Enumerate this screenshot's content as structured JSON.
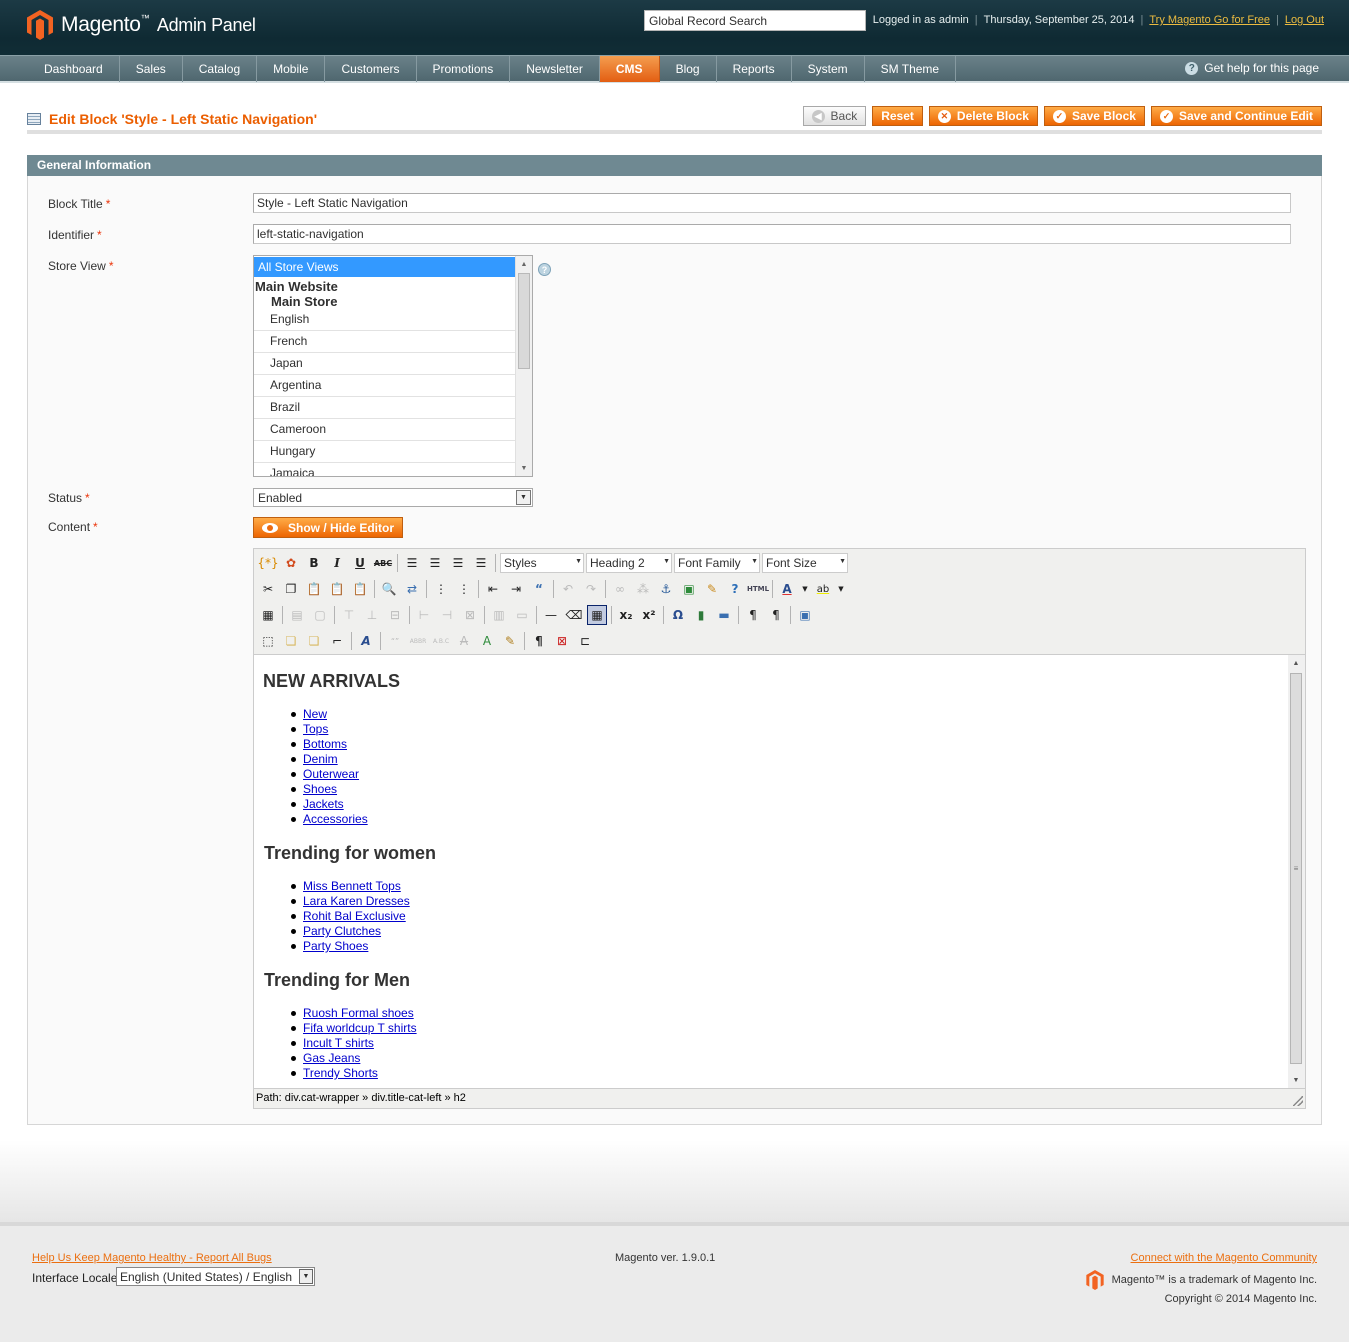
{
  "header": {
    "logo_text": "Magento",
    "logo_tm": "™",
    "logo_suffix": "Admin Panel",
    "search_value": "Global Record Search",
    "logged_in": "Logged in as admin",
    "date": "Thursday, September 25, 2014",
    "try_link": "Try Magento Go for Free",
    "logout": "Log Out",
    "brand_color": "#eb5e00"
  },
  "nav": {
    "items": [
      "Dashboard",
      "Sales",
      "Catalog",
      "Mobile",
      "Customers",
      "Promotions",
      "Newsletter",
      "CMS",
      "Blog",
      "Reports",
      "System",
      "SM Theme"
    ],
    "active": "CMS",
    "help": "Get help for this page"
  },
  "page": {
    "title": "Edit Block 'Style - Left Static Navigation'",
    "buttons": {
      "back": "Back",
      "reset": "Reset",
      "delete": "Delete Block",
      "save": "Save Block",
      "save_continue": "Save and Continue Edit"
    }
  },
  "form": {
    "section_title": "General Information",
    "block_title_label": "Block Title",
    "block_title_value": "Style - Left Static Navigation",
    "identifier_label": "Identifier",
    "identifier_value": "left-static-navigation",
    "store_view_label": "Store View",
    "store_views": {
      "all": "All Store Views",
      "website": "Main Website",
      "store": "Main Store",
      "views": [
        "English",
        "French",
        "Japan",
        "Argentina",
        "Brazil",
        "Cameroon",
        "Hungary",
        "Jamaica"
      ]
    },
    "status_label": "Status",
    "status_value": "Enabled",
    "content_label": "Content",
    "required_mark": "*",
    "show_hide_editor": "Show / Hide Editor"
  },
  "editor": {
    "toolbar": {
      "styles": "Styles",
      "heading": "Heading 2",
      "font_family": "Font Family",
      "font_size": "Font Size"
    },
    "sections": [
      {
        "heading": "NEW ARRIVALS",
        "links": [
          "New",
          "Tops",
          "Bottoms",
          "Denim",
          "Outerwear",
          "Shoes",
          "Jackets",
          "Accessories"
        ]
      },
      {
        "heading": "Trending for women",
        "links": [
          "Miss Bennett Tops",
          "Lara Karen Dresses",
          "Rohit Bal Exclusive",
          "Party Clutches",
          "Party Shoes"
        ]
      },
      {
        "heading": "Trending for Men",
        "links": [
          "Ruosh Formal shoes",
          "Fifa worldcup T shirts",
          "Incult T shirts",
          "Gas Jeans",
          "Trendy Shorts"
        ]
      }
    ],
    "path": "Path: div.cat-wrapper » div.title-cat-left » h2"
  },
  "footer": {
    "bugs_link": "Help Us Keep Magento Healthy - Report All Bugs",
    "locale_label": "Interface Locale:",
    "locale_value": "English (United States) / English",
    "version": "Magento ver. 1.9.0.1",
    "community_link": "Connect with the Magento Community",
    "trademark": "Magento™ is a trademark of Magento Inc.",
    "copyright": "Copyright © 2014 Magento Inc."
  }
}
